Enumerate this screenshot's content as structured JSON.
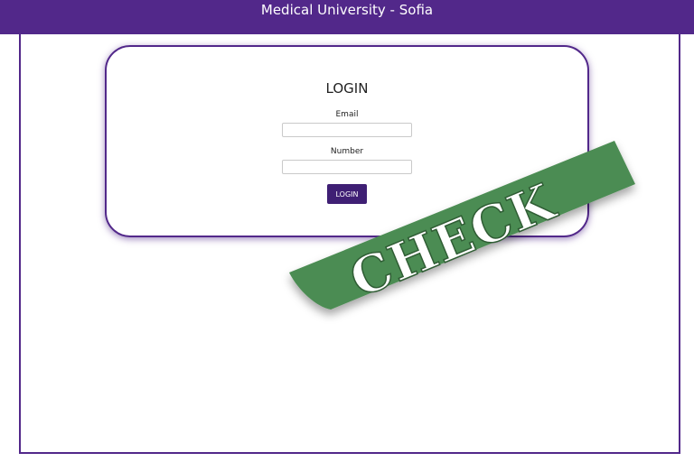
{
  "header": {
    "title": "Medical University - Sofia"
  },
  "login_card": {
    "title": "LOGIN",
    "email_label": "Email",
    "email_value": "",
    "number_label": "Number",
    "number_value": "",
    "button_label": "LOGIN"
  },
  "overlay": {
    "stamp_text": "CHECK"
  },
  "colors": {
    "brand": "#52288a",
    "button": "#3f1f74",
    "ribbon": "#4c8c52"
  }
}
